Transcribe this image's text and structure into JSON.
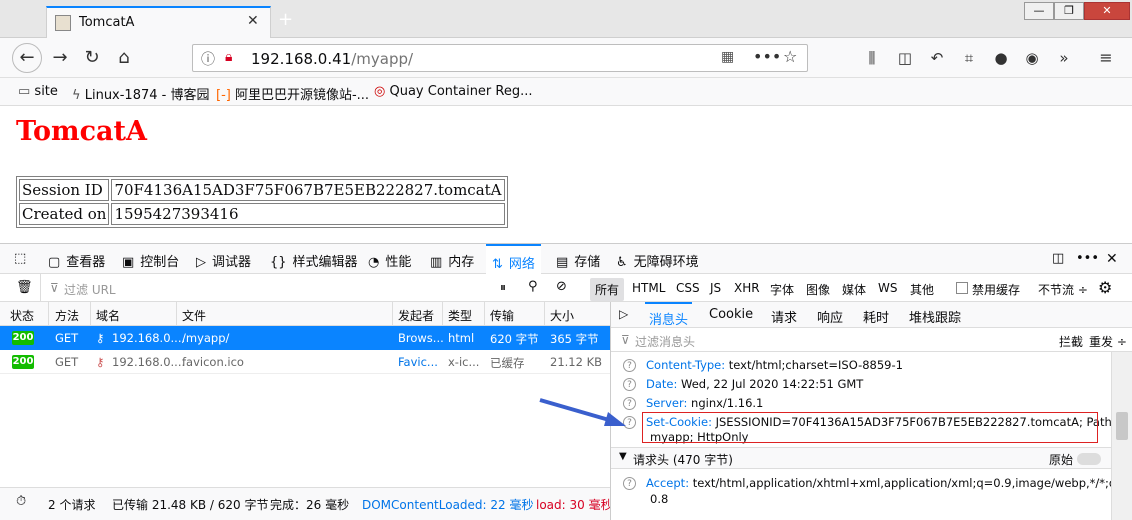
{
  "window": {
    "tab_title": "TomcatA",
    "new_tab": "+",
    "min": "—",
    "max": "❐",
    "close": "✕"
  },
  "nav": {
    "url_host": "192.168.0.41",
    "url_path": "/myapp/"
  },
  "bookmarks": [
    {
      "label": "site",
      "icon": "folder-icon"
    },
    {
      "label": "Linux-1874 - 博客园",
      "icon": "cnblogs-icon"
    },
    {
      "label": "阿里巴巴开源镜像站-...",
      "icon": "aliyun-icon"
    },
    {
      "label": "Quay Container Reg...",
      "icon": "quay-icon"
    }
  ],
  "page": {
    "title": "TomcatA",
    "rows": [
      {
        "label": "Session ID",
        "value": "70F4136A15AD3F75F067B7E5EB222827.tomcatA"
      },
      {
        "label": "Created on",
        "value": "1595427393416"
      }
    ]
  },
  "devtools": {
    "tools": [
      "查看器",
      "控制台",
      "调试器",
      "样式编辑器",
      "性能",
      "内存",
      "网络",
      "存储",
      "无障碍环境"
    ],
    "filter_placeholder": "过滤 URL",
    "types": [
      "所有",
      "HTML",
      "CSS",
      "JS",
      "XHR",
      "字体",
      "图像",
      "媒体",
      "WS",
      "其他"
    ],
    "disable_cache": "禁用缓存",
    "throttle": "不节流 ÷",
    "columns": [
      "状态",
      "方法",
      "域名",
      "文件",
      "发起者",
      "类型",
      "传输",
      "大小"
    ],
    "requests": [
      {
        "status": "200",
        "method": "GET",
        "domain": "192.168.0....",
        "file": "/myapp/",
        "initiator": "Brows...",
        "type": "html",
        "transfer": "620 字节",
        "size": "365 字节"
      },
      {
        "status": "200",
        "method": "GET",
        "domain": "192.168.0....",
        "file": "favicon.ico",
        "initiator": "Favic...",
        "type": "x-ic...",
        "transfer": "已缓存",
        "size": "21.12 KB"
      }
    ],
    "status": {
      "requests": "2 个请求",
      "transferred": "已传输 21.48 KB / 620 字节",
      "finish": "完成：26 毫秒",
      "dcl": "DOMContentLoaded: 22 毫秒",
      "load": "load: 30 毫秒"
    },
    "side_tabs": [
      "消息头",
      "Cookie",
      "请求",
      "响应",
      "耗时",
      "堆栈跟踪"
    ],
    "side_filter": "过滤消息头",
    "block": "拦截",
    "resend": "重发 ÷",
    "headers": [
      {
        "name": "Content-Type:",
        "value": "text/html;charset=ISO-8859-1"
      },
      {
        "name": "Date:",
        "value": "Wed, 22 Jul 2020 14:22:51 GMT"
      },
      {
        "name": "Server:",
        "value": "nginx/1.16.1"
      },
      {
        "name": "Set-Cookie:",
        "value": "JSESSIONID=70F4136A15AD3F75F067B7E5EB222827.tomcatA; Path=/",
        "value2": "myapp; HttpOnly"
      }
    ],
    "req_section": "请求头 (470 字节)",
    "raw": "原始",
    "accept": {
      "name": "Accept:",
      "value": "text/html,application/xhtml+xml,application/xml;q=0.9,image/webp,*/*;q=",
      "value2": "0.8"
    },
    "accent": "#0a84ff",
    "highlight_color": "#dd2222"
  }
}
